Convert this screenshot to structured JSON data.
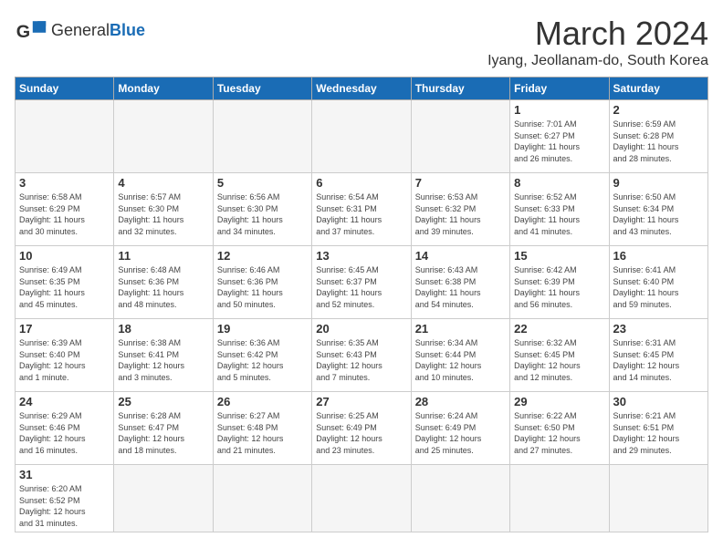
{
  "logo": {
    "text_general": "General",
    "text_blue": "Blue"
  },
  "title": "March 2024",
  "location": "Iyang, Jeollanam-do, South Korea",
  "days_of_week": [
    "Sunday",
    "Monday",
    "Tuesday",
    "Wednesday",
    "Thursday",
    "Friday",
    "Saturday"
  ],
  "weeks": [
    [
      {
        "day": "",
        "info": "",
        "empty": true
      },
      {
        "day": "",
        "info": "",
        "empty": true
      },
      {
        "day": "",
        "info": "",
        "empty": true
      },
      {
        "day": "",
        "info": "",
        "empty": true
      },
      {
        "day": "",
        "info": "",
        "empty": true
      },
      {
        "day": "1",
        "info": "Sunrise: 7:01 AM\nSunset: 6:27 PM\nDaylight: 11 hours\nand 26 minutes."
      },
      {
        "day": "2",
        "info": "Sunrise: 6:59 AM\nSunset: 6:28 PM\nDaylight: 11 hours\nand 28 minutes."
      }
    ],
    [
      {
        "day": "3",
        "info": "Sunrise: 6:58 AM\nSunset: 6:29 PM\nDaylight: 11 hours\nand 30 minutes."
      },
      {
        "day": "4",
        "info": "Sunrise: 6:57 AM\nSunset: 6:30 PM\nDaylight: 11 hours\nand 32 minutes."
      },
      {
        "day": "5",
        "info": "Sunrise: 6:56 AM\nSunset: 6:30 PM\nDaylight: 11 hours\nand 34 minutes."
      },
      {
        "day": "6",
        "info": "Sunrise: 6:54 AM\nSunset: 6:31 PM\nDaylight: 11 hours\nand 37 minutes."
      },
      {
        "day": "7",
        "info": "Sunrise: 6:53 AM\nSunset: 6:32 PM\nDaylight: 11 hours\nand 39 minutes."
      },
      {
        "day": "8",
        "info": "Sunrise: 6:52 AM\nSunset: 6:33 PM\nDaylight: 11 hours\nand 41 minutes."
      },
      {
        "day": "9",
        "info": "Sunrise: 6:50 AM\nSunset: 6:34 PM\nDaylight: 11 hours\nand 43 minutes."
      }
    ],
    [
      {
        "day": "10",
        "info": "Sunrise: 6:49 AM\nSunset: 6:35 PM\nDaylight: 11 hours\nand 45 minutes."
      },
      {
        "day": "11",
        "info": "Sunrise: 6:48 AM\nSunset: 6:36 PM\nDaylight: 11 hours\nand 48 minutes."
      },
      {
        "day": "12",
        "info": "Sunrise: 6:46 AM\nSunset: 6:36 PM\nDaylight: 11 hours\nand 50 minutes."
      },
      {
        "day": "13",
        "info": "Sunrise: 6:45 AM\nSunset: 6:37 PM\nDaylight: 11 hours\nand 52 minutes."
      },
      {
        "day": "14",
        "info": "Sunrise: 6:43 AM\nSunset: 6:38 PM\nDaylight: 11 hours\nand 54 minutes."
      },
      {
        "day": "15",
        "info": "Sunrise: 6:42 AM\nSunset: 6:39 PM\nDaylight: 11 hours\nand 56 minutes."
      },
      {
        "day": "16",
        "info": "Sunrise: 6:41 AM\nSunset: 6:40 PM\nDaylight: 11 hours\nand 59 minutes."
      }
    ],
    [
      {
        "day": "17",
        "info": "Sunrise: 6:39 AM\nSunset: 6:40 PM\nDaylight: 12 hours\nand 1 minute."
      },
      {
        "day": "18",
        "info": "Sunrise: 6:38 AM\nSunset: 6:41 PM\nDaylight: 12 hours\nand 3 minutes."
      },
      {
        "day": "19",
        "info": "Sunrise: 6:36 AM\nSunset: 6:42 PM\nDaylight: 12 hours\nand 5 minutes."
      },
      {
        "day": "20",
        "info": "Sunrise: 6:35 AM\nSunset: 6:43 PM\nDaylight: 12 hours\nand 7 minutes."
      },
      {
        "day": "21",
        "info": "Sunrise: 6:34 AM\nSunset: 6:44 PM\nDaylight: 12 hours\nand 10 minutes."
      },
      {
        "day": "22",
        "info": "Sunrise: 6:32 AM\nSunset: 6:45 PM\nDaylight: 12 hours\nand 12 minutes."
      },
      {
        "day": "23",
        "info": "Sunrise: 6:31 AM\nSunset: 6:45 PM\nDaylight: 12 hours\nand 14 minutes."
      }
    ],
    [
      {
        "day": "24",
        "info": "Sunrise: 6:29 AM\nSunset: 6:46 PM\nDaylight: 12 hours\nand 16 minutes."
      },
      {
        "day": "25",
        "info": "Sunrise: 6:28 AM\nSunset: 6:47 PM\nDaylight: 12 hours\nand 18 minutes."
      },
      {
        "day": "26",
        "info": "Sunrise: 6:27 AM\nSunset: 6:48 PM\nDaylight: 12 hours\nand 21 minutes."
      },
      {
        "day": "27",
        "info": "Sunrise: 6:25 AM\nSunset: 6:49 PM\nDaylight: 12 hours\nand 23 minutes."
      },
      {
        "day": "28",
        "info": "Sunrise: 6:24 AM\nSunset: 6:49 PM\nDaylight: 12 hours\nand 25 minutes."
      },
      {
        "day": "29",
        "info": "Sunrise: 6:22 AM\nSunset: 6:50 PM\nDaylight: 12 hours\nand 27 minutes."
      },
      {
        "day": "30",
        "info": "Sunrise: 6:21 AM\nSunset: 6:51 PM\nDaylight: 12 hours\nand 29 minutes."
      }
    ],
    [
      {
        "day": "31",
        "info": "Sunrise: 6:20 AM\nSunset: 6:52 PM\nDaylight: 12 hours\nand 31 minutes."
      },
      {
        "day": "",
        "info": "",
        "empty": true
      },
      {
        "day": "",
        "info": "",
        "empty": true
      },
      {
        "day": "",
        "info": "",
        "empty": true
      },
      {
        "day": "",
        "info": "",
        "empty": true
      },
      {
        "day": "",
        "info": "",
        "empty": true
      },
      {
        "day": "",
        "info": "",
        "empty": true
      }
    ]
  ]
}
